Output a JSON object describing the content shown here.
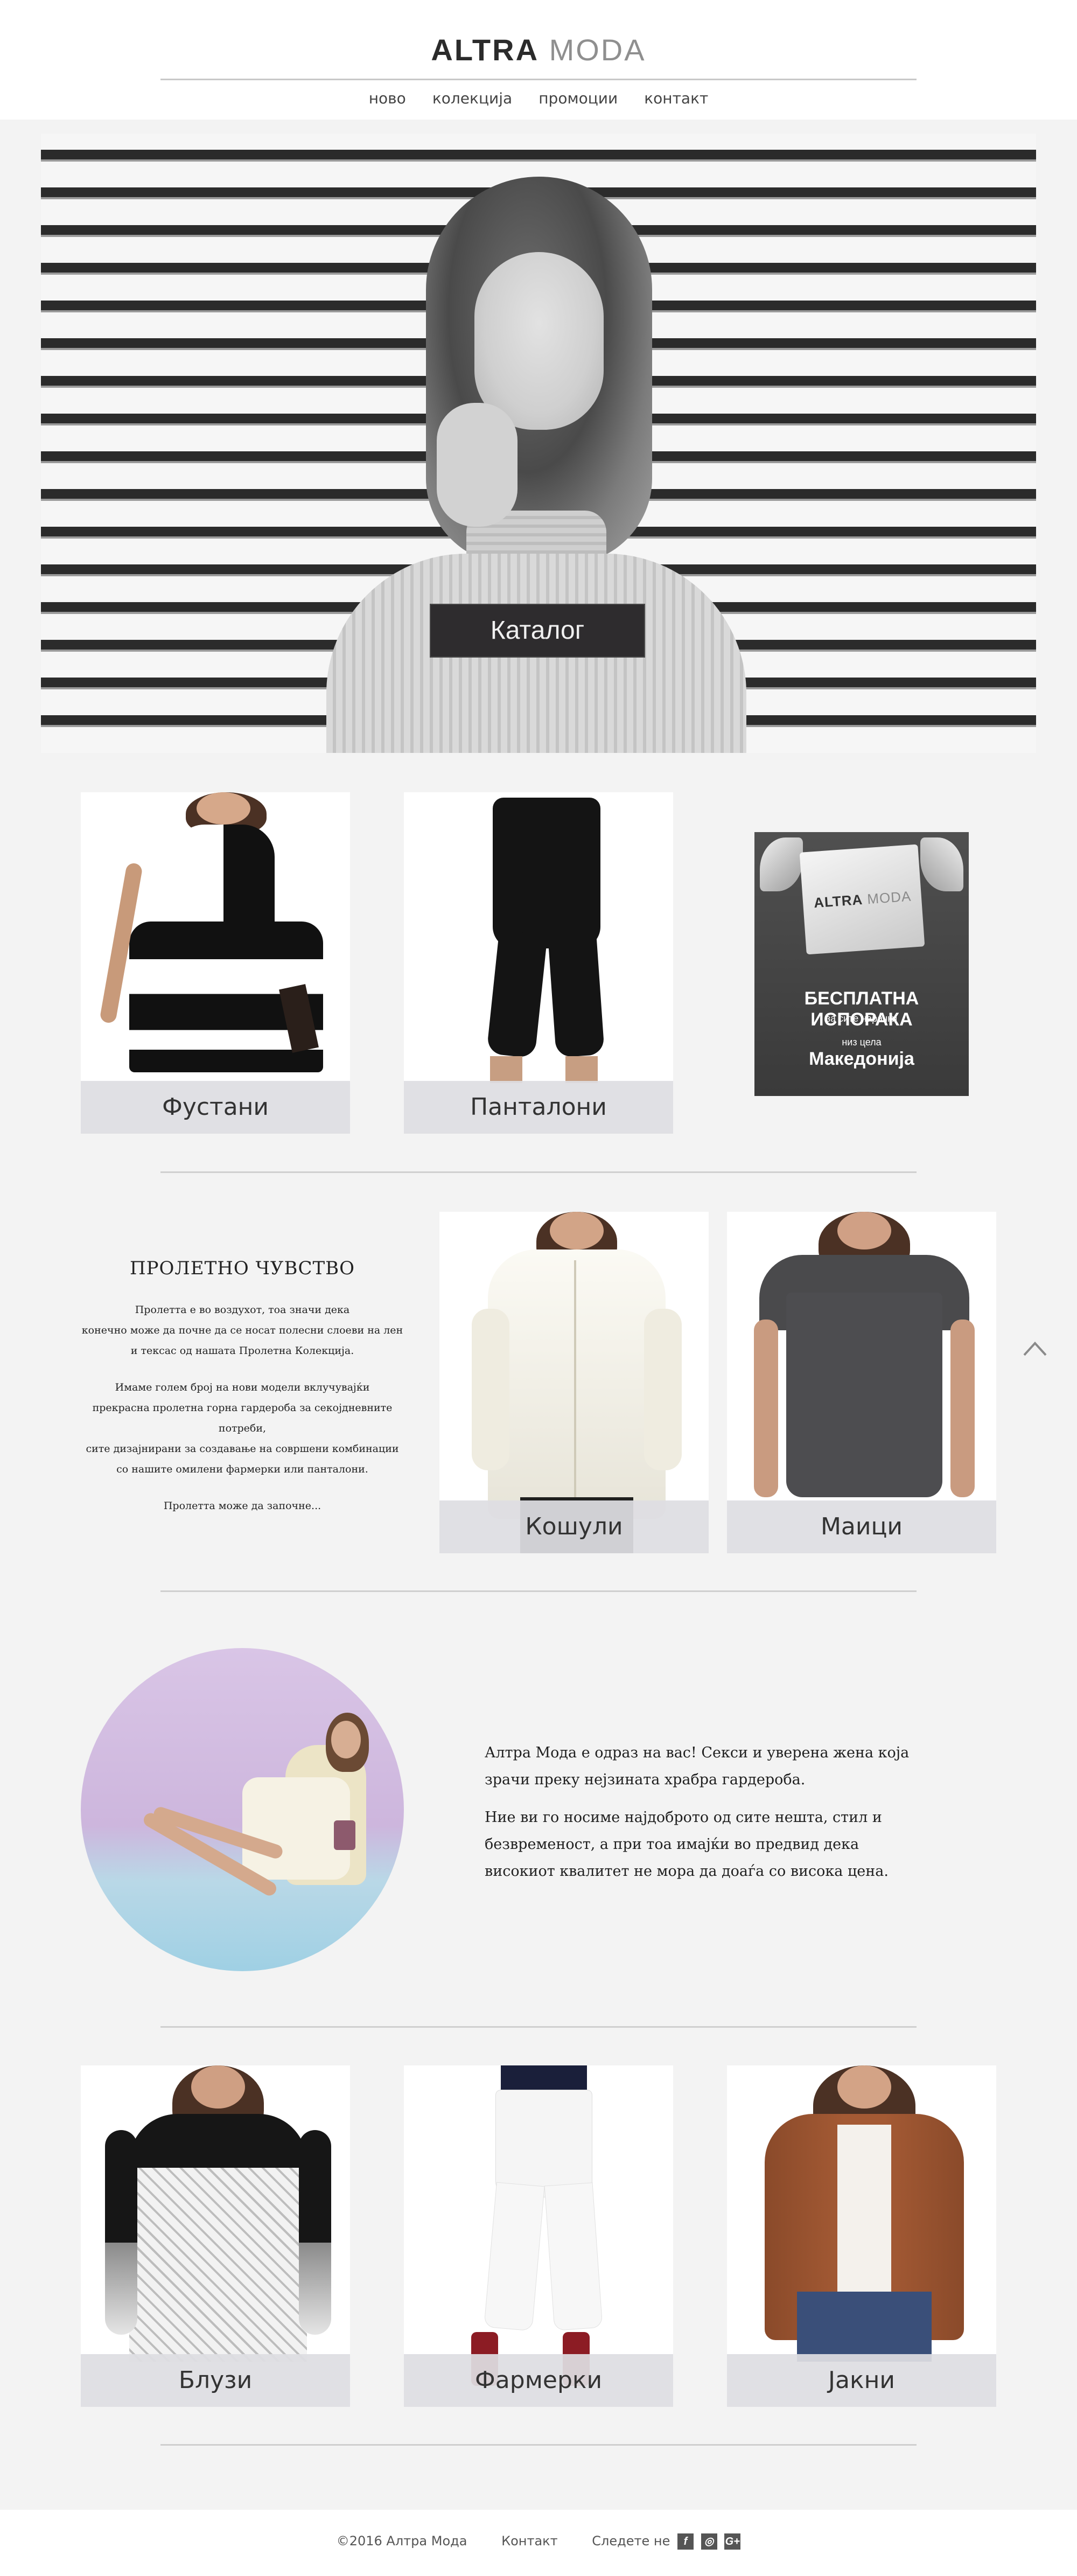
{
  "header": {
    "logo_part1": "ALTRA",
    "logo_part2": "MODA",
    "nav": [
      "ново",
      "колекција",
      "промоции",
      "контакт"
    ]
  },
  "hero": {
    "button_label": "Каталог"
  },
  "products_row1": [
    {
      "label": "Фустани"
    },
    {
      "label": "Панталони"
    }
  ],
  "promo": {
    "bag_logo_part1": "ALTRA",
    "bag_logo_part2": "MODA",
    "line1": "БЕСПЛАТНА ИСПОРАКА",
    "line2": "за сите нарачки",
    "line3": "низ цела",
    "line4": "Македонија"
  },
  "spring": {
    "title": "ПРОЛЕТНО ЧУВСТВО",
    "para1_line1": "Пролетта е во воздухот, тоа значи дека",
    "para1_line2": "конечно може да почне да се носат полесни слоеви на лен",
    "para1_line3": "и тексас од нашата Пролетна Колекција.",
    "para2_line1": "Имаме голем број на нови модели вклучувајќи",
    "para2_line2": "прекрасна пролетна горна гардероба за секојдневните потреби,",
    "para2_line3": "сите дизајнирани за создавање на совршени комбинации",
    "para2_line4": "со нашите омилени фармерки или панталони.",
    "para3": "Пролетта може да започне..."
  },
  "products_row2": [
    {
      "label": "Кошули"
    },
    {
      "label": "Маици"
    }
  ],
  "about": {
    "para1": "Алтра Мода е одраз на вас! Секси и уверена жена која зрачи преку нејзината храбра гардероба.",
    "para2": "Ние ви го носиме најдоброто од сите нешта, стил и безвременост, а при тоа имајќи во предвид дека високиот квалитет не мора да доаѓа со висока цена."
  },
  "products_row3": [
    {
      "label": "Блузи"
    },
    {
      "label": "Фармерки"
    },
    {
      "label": "Јакни"
    }
  ],
  "footer": {
    "copyright": "©2016 Алтра Мода",
    "contact": "Контакт",
    "follow": "Следете не",
    "social": [
      "facebook-icon",
      "instagram-icon",
      "google-plus-icon"
    ]
  },
  "colors": {
    "page_bg": "#f3f3f3",
    "button_bg": "#2e2c2e",
    "label_bg": "#dedee2"
  }
}
